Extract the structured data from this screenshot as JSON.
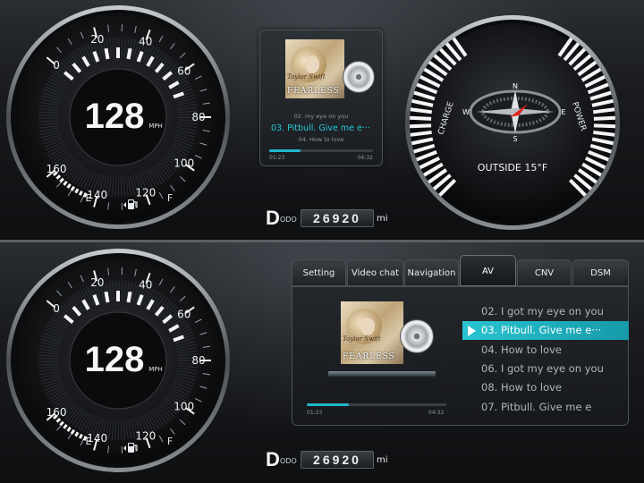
{
  "cluster": {
    "speedometer": {
      "speed": "128",
      "unit": "MPH",
      "ticks": [
        "0",
        "20",
        "40",
        "60",
        "80",
        "100",
        "120",
        "140",
        "160"
      ],
      "fuel_empty": "E",
      "fuel_full": "F"
    },
    "compass": {
      "charge_label": "CHARGE",
      "power_label": "POWER",
      "north": "N",
      "south": "S",
      "east": "E",
      "west": "W",
      "outside_temp": "OUTSIDE 15°F"
    },
    "odometer": {
      "gear": "D",
      "label": "ODO",
      "value": "26920",
      "unit": "mi"
    }
  },
  "media_mini": {
    "album_artist": "Taylor Swift",
    "album_title": "FEARLESS",
    "prev_track": "02. my eye on you",
    "current_track": "03. Pitbull. Give me e···",
    "next_track": "04. How to love",
    "elapsed": "01:23",
    "total": "04:32",
    "progress": 0.3
  },
  "tabs": [
    {
      "label": "Setting"
    },
    {
      "label": "Video chat"
    },
    {
      "label": "Navigation"
    },
    {
      "label": "AV"
    },
    {
      "label": "CNV"
    },
    {
      "label": "DSM"
    }
  ],
  "active_tab": "AV",
  "av_panel": {
    "album_artist": "Taylor Swift",
    "album_title": "FEARLESS",
    "elapsed": "01:23",
    "total": "04:32",
    "progress": 0.3,
    "playlist": [
      {
        "label": "02. I got my eye on you"
      },
      {
        "label": "03. Pitbull. Give me e···"
      },
      {
        "label": "04. How to love"
      },
      {
        "label": "06. I got my eye on you"
      },
      {
        "label": "08. How to love"
      },
      {
        "label": "07. Pitbull. Give me e"
      }
    ],
    "current_index": 1
  },
  "colors": {
    "accent": "#25c9d6",
    "accent_dark": "#169aa8",
    "compass_needle": "#e0241b"
  }
}
